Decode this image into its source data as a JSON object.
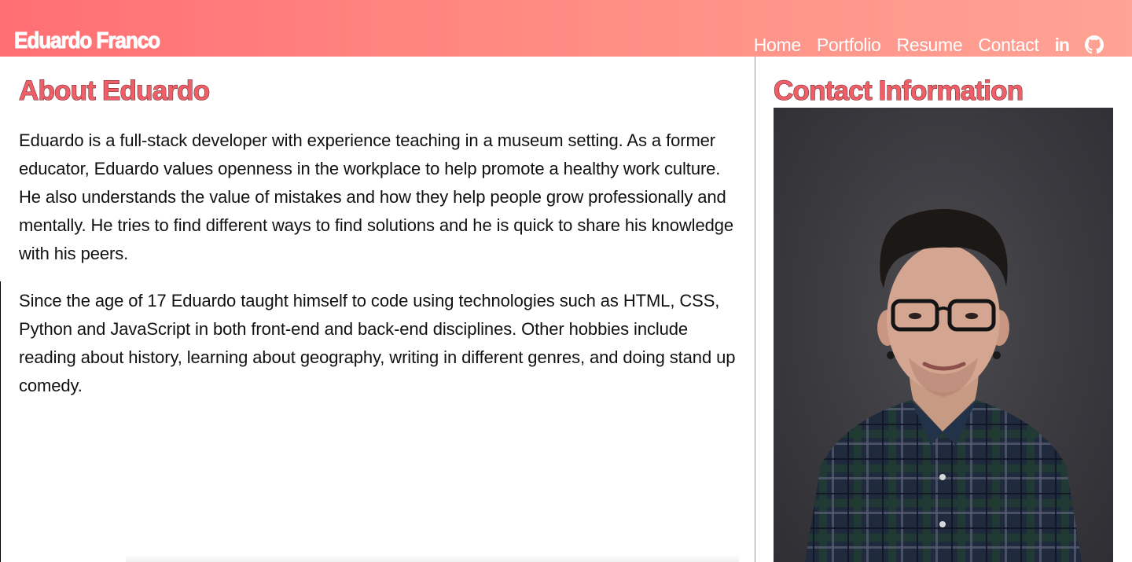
{
  "header": {
    "brand": "Eduardo Franco",
    "nav": [
      {
        "label": "Home"
      },
      {
        "label": "Portfolio"
      },
      {
        "label": "Resume"
      },
      {
        "label": "Contact"
      }
    ],
    "icons": [
      "linkedin-icon",
      "github-icon"
    ],
    "linkedin_text": "in",
    "gradient": [
      "#ff6f73",
      "#ffa394"
    ]
  },
  "about": {
    "title": "About Eduardo",
    "paragraphs": [
      "Eduardo is a full-stack developer with experience teaching in a museum setting. As a former educator, Eduardo values openness in the workplace to help promote a healthy work culture. He also understands the value of mistakes and how they help people grow professionally and mentally. He tries to find different ways to find solutions and he is quick to share his knowledge with his peers.",
      "Since the age of 17 Eduardo taught himself to code using technologies such as HTML, CSS, Python and JavaScript in both front-end and back-end disciplines. Other hobbies include reading about history, learning about geography, writing in different genres, and doing stand up comedy."
    ]
  },
  "contact": {
    "title": "Contact Information"
  },
  "colors": {
    "accent": "#f05f67",
    "accent_stroke": "#6a2a2e"
  }
}
